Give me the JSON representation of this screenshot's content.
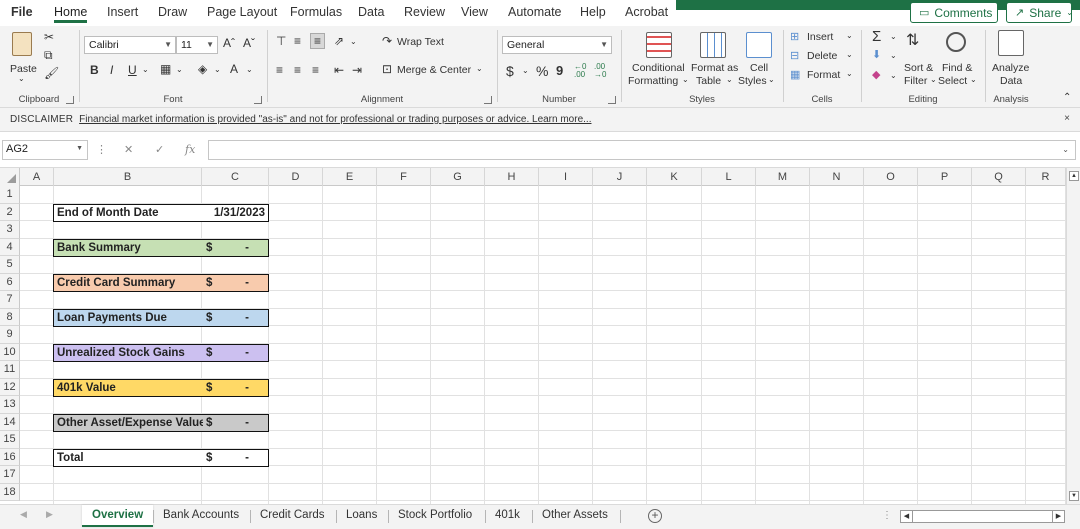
{
  "tabs": {
    "file": "File",
    "home": "Home",
    "insert": "Insert",
    "draw": "Draw",
    "page_layout": "Page Layout",
    "formulas": "Formulas",
    "data": "Data",
    "review": "Review",
    "view": "View",
    "automate": "Automate",
    "help": "Help",
    "acrobat": "Acrobat"
  },
  "topbar": {
    "comments": "Comments",
    "share": "Share"
  },
  "ribbon": {
    "clipboard": {
      "label": "Clipboard",
      "paste": "Paste"
    },
    "font": {
      "label": "Font",
      "family": "Calibri",
      "size": "11",
      "bold": "B",
      "italic": "I",
      "underline": "U"
    },
    "alignment": {
      "label": "Alignment",
      "wrap_text": "Wrap Text",
      "merge_center": "Merge & Center"
    },
    "number": {
      "label": "Number",
      "format": "General",
      "currency": "$",
      "percent": "%",
      "comma": "9"
    },
    "styles": {
      "label": "Styles",
      "conditional_1": "Conditional",
      "conditional_2": "Formatting",
      "format_table_1": "Format as",
      "format_table_2": "Table",
      "cell_styles_1": "Cell",
      "cell_styles_2": "Styles"
    },
    "cells": {
      "label": "Cells",
      "insert": "Insert",
      "delete": "Delete",
      "format": "Format"
    },
    "editing": {
      "label": "Editing",
      "sort_1": "Sort &",
      "sort_2": "Filter",
      "find_1": "Find &",
      "find_2": "Select"
    },
    "analysis": {
      "label": "Analysis",
      "analyze_1": "Analyze",
      "analyze_2": "Data"
    }
  },
  "disclaimer": {
    "title": "DISCLAIMER",
    "text": "Financial market information is provided \"as-is\" and not for professional or trading purposes or advice. Learn more...",
    "close": "×"
  },
  "formula_bar": {
    "name_box": "AG2",
    "fx": "fx",
    "value": ""
  },
  "columns": [
    "A",
    "B",
    "C",
    "D",
    "E",
    "F",
    "G",
    "H",
    "I",
    "J",
    "K",
    "L",
    "M",
    "N",
    "O",
    "P",
    "Q",
    "R"
  ],
  "rows": [
    "1",
    "2",
    "3",
    "4",
    "5",
    "6",
    "7",
    "8",
    "9",
    "10",
    "11",
    "12",
    "13",
    "14",
    "15",
    "16",
    "17",
    "18"
  ],
  "summary": [
    {
      "row": "2",
      "label": "End of Month Date",
      "value": "1/31/2023",
      "color": "#ffffff"
    },
    {
      "row": "4",
      "label": "Bank Summary",
      "dollar": "$",
      "value": "-",
      "color": "#c6e0b4"
    },
    {
      "row": "6",
      "label": "Credit Card Summary",
      "dollar": "$",
      "value": "-",
      "color": "#f8cbad"
    },
    {
      "row": "8",
      "label": "Loan Payments Due",
      "dollar": "$",
      "value": "-",
      "color": "#bdd7ee"
    },
    {
      "row": "10",
      "label": "Unrealized Stock Gains",
      "dollar": "$",
      "value": "-",
      "color": "#ccc0f0"
    },
    {
      "row": "12",
      "label": "401k Value",
      "dollar": "$",
      "value": "-",
      "color": "#ffd966"
    },
    {
      "row": "14",
      "label": "Other Asset/Expense Values",
      "dollar": "$",
      "value": "-",
      "color": "#c9c9c9"
    },
    {
      "row": "16",
      "label": "Total",
      "dollar": "$",
      "value": "-",
      "color": "#ffffff"
    }
  ],
  "sheets": [
    "Overview",
    "Bank Accounts",
    "Credit Cards",
    "Loans",
    "Stock Portfolio",
    "401k",
    "Other Assets"
  ],
  "active_sheet": "Overview",
  "accent_color": "#1e7145"
}
